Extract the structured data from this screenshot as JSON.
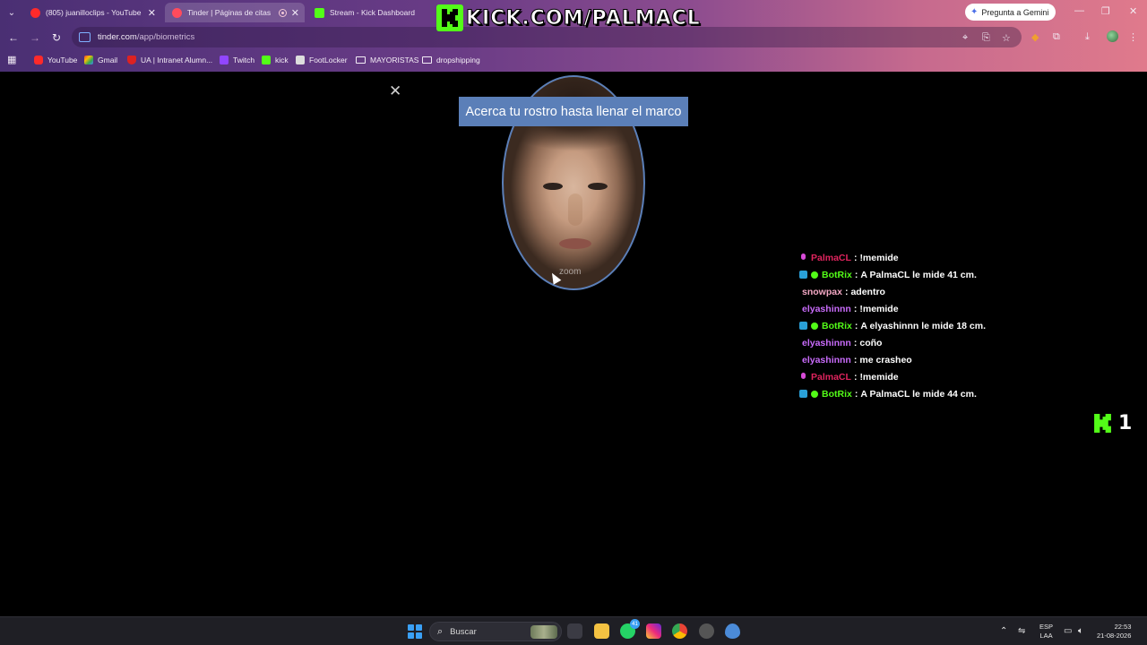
{
  "browser": {
    "tabs": [
      {
        "title": "(805) juanilloclips - YouTube",
        "icon": "youtube-icon",
        "active": false
      },
      {
        "title": "Tinder | Páginas de citas",
        "icon": "tinder-icon",
        "active": true
      },
      {
        "title": "Stream - Kick Dashboard",
        "icon": "kick-icon",
        "active": false
      }
    ],
    "gemini_label": "Pregunta a Gemini",
    "url_host": "tinder.com",
    "url_path": "/app/biometrics",
    "bookmarks": [
      {
        "label": "YouTube",
        "icon": "youtube-icon"
      },
      {
        "label": "Gmail",
        "icon": "gmail-icon"
      },
      {
        "label": "UA | Intranet Alumn...",
        "icon": "shield-icon"
      },
      {
        "label": "Twitch",
        "icon": "twitch-icon"
      },
      {
        "label": "kick",
        "icon": "kick-icon"
      },
      {
        "label": "FootLocker",
        "icon": "footlocker-icon"
      },
      {
        "label": "MAYORISTAS",
        "icon": "folder-icon"
      },
      {
        "label": "dropshipping",
        "icon": "folder-icon"
      }
    ]
  },
  "overlay": {
    "banner_text": "KICK.COM/PALMACL",
    "viewer_count": "1"
  },
  "page": {
    "instruction": "Acerca tu rostro hasta llenar el marco",
    "watermark": "zoom"
  },
  "chat": [
    {
      "user": "PalmaCL",
      "color": "#e0245e",
      "badge": "mic",
      "verified": false,
      "text": "!memide"
    },
    {
      "user": "BotRix",
      "color": "#53fc18",
      "badge": "bot",
      "verified": true,
      "text": "A PalmaCL le mide 41 cm."
    },
    {
      "user": "snowpax",
      "color": "#f2a7c3",
      "badge": "",
      "verified": false,
      "text": "adentro"
    },
    {
      "user": "elyashinnn",
      "color": "#c86bfa",
      "badge": "",
      "verified": false,
      "text": "!memide"
    },
    {
      "user": "BotRix",
      "color": "#53fc18",
      "badge": "bot",
      "verified": true,
      "text": "A elyashinnn le mide 18 cm."
    },
    {
      "user": "elyashinnn",
      "color": "#c86bfa",
      "badge": "",
      "verified": false,
      "text": "coño"
    },
    {
      "user": "elyashinnn",
      "color": "#c86bfa",
      "badge": "",
      "verified": false,
      "text": "me crasheo"
    },
    {
      "user": "PalmaCL",
      "color": "#e0245e",
      "badge": "mic",
      "verified": false,
      "text": "!memide"
    },
    {
      "user": "BotRix",
      "color": "#53fc18",
      "badge": "bot",
      "verified": true,
      "text": "A PalmaCL le mide 44 cm."
    }
  ],
  "taskbar": {
    "search_placeholder": "Buscar",
    "whatsapp_badge": "41",
    "lang_line1": "ESP",
    "lang_line2": "LAA",
    "time": "22:53",
    "date": "21-08-2026"
  }
}
